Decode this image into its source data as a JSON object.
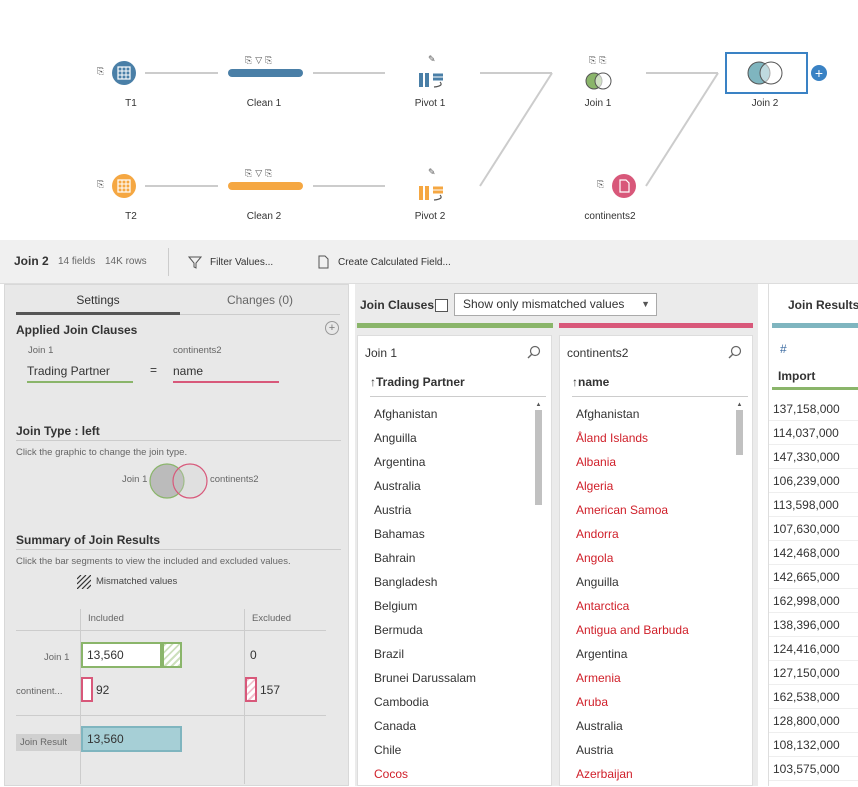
{
  "flow": {
    "nodes": {
      "t1": "T1",
      "clean1": "Clean 1",
      "pivot1": "Pivot 1",
      "join1": "Join 1",
      "join2": "Join 2",
      "t2": "T2",
      "clean2": "Clean 2",
      "pivot2": "Pivot 2",
      "continents2": "continents2"
    },
    "colors": {
      "blue": "#4a7fa7",
      "orange": "#f5a742",
      "pink": "#d8587a",
      "green": "#8ab56a",
      "teal": "#7fb5bf"
    }
  },
  "header": {
    "step_name": "Join 2",
    "fields": "14 fields",
    "rows": "14K rows",
    "filter_values": "Filter Values...",
    "create_calc": "Create Calculated Field..."
  },
  "left": {
    "tabs": {
      "settings": "Settings",
      "changes": "Changes (0)"
    },
    "applied_title": "Applied Join Clauses",
    "left_input": "Join 1",
    "right_input": "continents2",
    "left_field": "Trading Partner",
    "operator": "=",
    "right_field": "name",
    "join_type_title": "Join Type : left",
    "join_type_help": "Click the graphic to change the join type.",
    "venn_left": "Join 1",
    "venn_right": "continents2",
    "summary_title": "Summary of Join Results",
    "summary_help": "Click the bar segments to view the included and excluded values.",
    "mismatched_label": "Mismatched values",
    "col_included": "Included",
    "col_excluded": "Excluded",
    "row1_label": "Join 1",
    "row1_included": "13,560",
    "row1_excluded": "0",
    "row2_label": "continent...",
    "row2_included": "92",
    "row2_excluded": "157",
    "result_label": "Join Result",
    "result_value": "13,560"
  },
  "mid": {
    "title": "Join Clauses",
    "dropdown": "Show only mismatched values",
    "left_list_title": "Join 1",
    "left_col": "Trading Partner",
    "right_list_title": "continents2",
    "right_col": "name",
    "left_items": [
      {
        "t": "Afghanistan"
      },
      {
        "t": "Anguilla"
      },
      {
        "t": "Argentina"
      },
      {
        "t": "Australia"
      },
      {
        "t": "Austria"
      },
      {
        "t": "Bahamas"
      },
      {
        "t": "Bahrain"
      },
      {
        "t": "Bangladesh"
      },
      {
        "t": "Belgium"
      },
      {
        "t": "Bermuda"
      },
      {
        "t": "Brazil"
      },
      {
        "t": "Brunei Darussalam"
      },
      {
        "t": "Cambodia"
      },
      {
        "t": "Canada"
      },
      {
        "t": "Chile"
      },
      {
        "t": "Cocos",
        "m": true
      }
    ],
    "right_items": [
      {
        "t": "Afghanistan"
      },
      {
        "t": "Åland Islands",
        "m": true
      },
      {
        "t": "Albania",
        "m": true
      },
      {
        "t": "Algeria",
        "m": true
      },
      {
        "t": "American Samoa",
        "m": true
      },
      {
        "t": "Andorra",
        "m": true
      },
      {
        "t": "Angola",
        "m": true
      },
      {
        "t": "Anguilla"
      },
      {
        "t": "Antarctica",
        "m": true
      },
      {
        "t": "Antigua and Barbuda",
        "m": true
      },
      {
        "t": "Argentina"
      },
      {
        "t": "Armenia",
        "m": true
      },
      {
        "t": "Aruba",
        "m": true
      },
      {
        "t": "Australia"
      },
      {
        "t": "Austria"
      },
      {
        "t": "Azerbaijan",
        "m": true
      }
    ]
  },
  "right": {
    "title": "Join Results",
    "type_icon": "#",
    "col": "Import",
    "values": [
      "137,158,000",
      "114,037,000",
      "147,330,000",
      "106,239,000",
      "113,598,000",
      "107,630,000",
      "142,468,000",
      "142,665,000",
      "162,998,000",
      "138,396,000",
      "124,416,000",
      "127,150,000",
      "162,538,000",
      "128,800,000",
      "108,132,000",
      "103,575,000"
    ]
  }
}
